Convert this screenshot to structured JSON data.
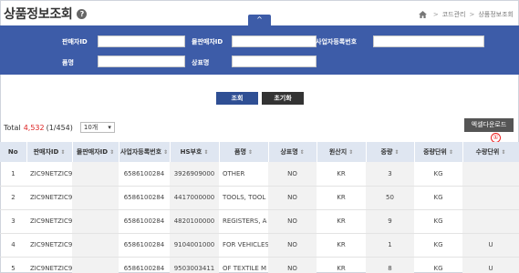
{
  "page": {
    "title": "상품정보조회",
    "help_icon": "?",
    "breadcrumb": [
      "코드관리",
      "상품정보조회"
    ]
  },
  "search": {
    "collapse_glyph": "^",
    "fields": [
      {
        "label": "판매자ID",
        "value": ""
      },
      {
        "label": "몰판매자ID",
        "value": ""
      },
      {
        "label": "사업자등록번호",
        "value": ""
      },
      {
        "label": "품명",
        "value": ""
      },
      {
        "label": "상표명",
        "value": ""
      }
    ],
    "search_button": "조회",
    "reset_button": "초기화"
  },
  "results": {
    "total_label": "Total",
    "total_count": "4,532",
    "page_info": "(1/454)",
    "page_size": "10개",
    "excel_button": "엑셀다운로드",
    "marker": "①"
  },
  "table": {
    "columns": [
      "No",
      "판매자ID",
      "몰판매자ID",
      "사업자등록번호",
      "HS부호",
      "품명",
      "상표명",
      "원산지",
      "중량",
      "중량단위",
      "수량단위"
    ],
    "rows": [
      [
        "1",
        "ZIC9NETZIC9",
        "",
        "6586100284",
        "3926909000",
        "OTHER",
        "NO",
        "KR",
        "3",
        "KG",
        ""
      ],
      [
        "2",
        "ZIC9NETZIC9",
        "",
        "6586100284",
        "4417000000",
        "TOOLS, TOOL",
        "NO",
        "KR",
        "50",
        "KG",
        ""
      ],
      [
        "3",
        "ZIC9NETZIC9",
        "",
        "6586100284",
        "4820100000",
        "REGISTERS, A",
        "NO",
        "KR",
        "9",
        "KG",
        ""
      ],
      [
        "4",
        "ZIC9NETZIC9",
        "",
        "6586100284",
        "9104001000",
        "FOR VEHICLES",
        "NO",
        "KR",
        "1",
        "KG",
        "U"
      ],
      [
        "5",
        "ZIC9NETZIC9",
        "",
        "6586100284",
        "9503003411",
        "OF TEXTILE M",
        "NO",
        "KR",
        "8",
        "KG",
        "U"
      ]
    ]
  },
  "colors": {
    "panel": "#3d5ca8",
    "header_row": "#dfe6f1",
    "total_count": "#dd2222"
  }
}
